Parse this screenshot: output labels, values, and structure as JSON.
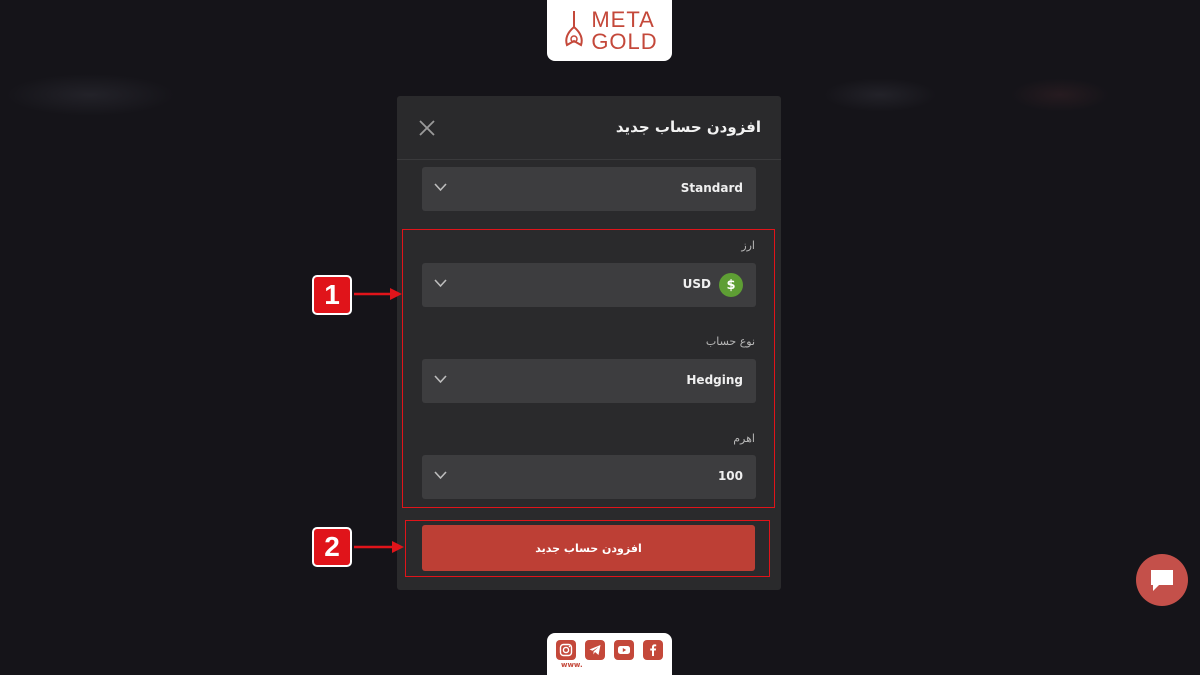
{
  "brand": {
    "line1": "META",
    "line2": "GOLD",
    "color": "#c4483a"
  },
  "social": {
    "www": "www.",
    "icons": [
      "instagram-icon",
      "telegram-icon",
      "youtube-icon",
      "facebook-icon"
    ]
  },
  "modal": {
    "title": "افزودن حساب جدید",
    "platform_select": {
      "value": "Standard"
    },
    "currency": {
      "label": "ارز",
      "value": "USD",
      "symbol": "$"
    },
    "account_type": {
      "label": "نوع حساب",
      "value": "Hedging"
    },
    "leverage": {
      "label": "اهرم",
      "value": "100"
    },
    "submit_label": "افزودن حساب جدید"
  },
  "annotations": {
    "step1": "1",
    "step2": "2",
    "color": "#e0141a"
  },
  "colors": {
    "accent": "#bd3f35",
    "modal_bg": "#2a2a2c",
    "field_bg": "#3d3d3f",
    "coin": "#5e9e34"
  }
}
